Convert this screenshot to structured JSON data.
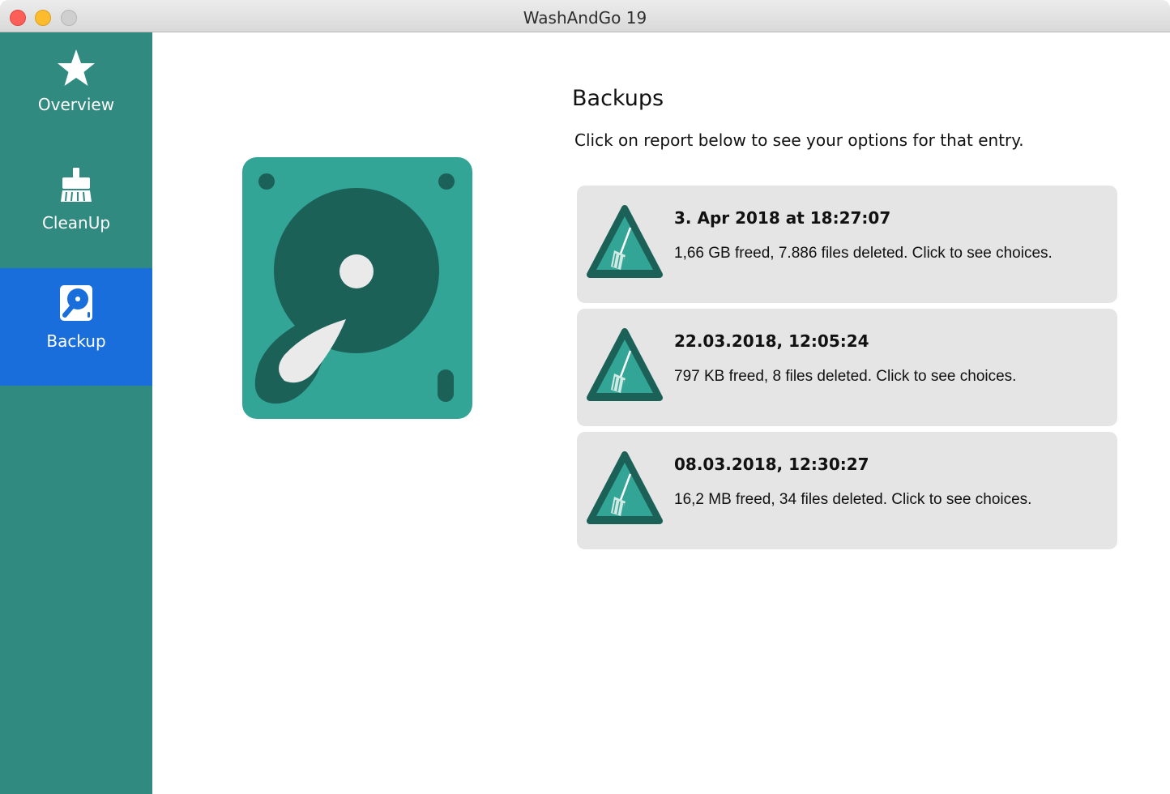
{
  "window": {
    "title": "WashAndGo 19"
  },
  "colors": {
    "sidebar": "#318a7f",
    "sidebar_active": "#1a6edb",
    "icon_teal": "#33a596",
    "icon_dark": "#1b6158",
    "card_bg": "#e5e5e5"
  },
  "sidebar": {
    "items": [
      {
        "label": "Overview",
        "icon": "star-icon",
        "active": false
      },
      {
        "label": "CleanUp",
        "icon": "broom-icon",
        "active": false
      },
      {
        "label": "Backup",
        "icon": "hard-drive-icon",
        "active": true
      }
    ]
  },
  "main": {
    "hero_icon": "hard-drive-icon",
    "title": "Backups",
    "subtitle": "Click on report below to see your options for that entry.",
    "reports": [
      {
        "date": "3. Apr 2018 at 18:27:07",
        "summary": "1,66 GB freed, 7.886 files deleted. Click to see choices.",
        "icon": "broom-warning-icon"
      },
      {
        "date": "22.03.2018, 12:05:24",
        "summary": "797 KB freed, 8 files deleted. Click to see choices.",
        "icon": "broom-warning-icon"
      },
      {
        "date": "08.03.2018, 12:30:27",
        "summary": "16,2 MB freed, 34 files deleted. Click to see choices.",
        "icon": "broom-warning-icon"
      }
    ]
  }
}
